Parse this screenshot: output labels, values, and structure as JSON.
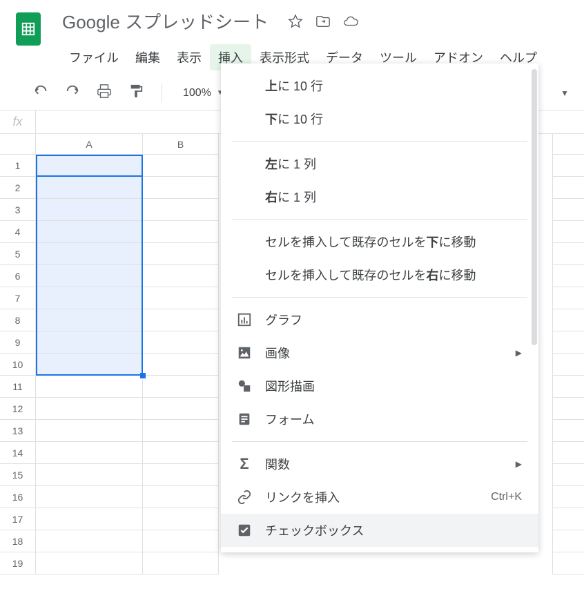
{
  "doc_title": "Google スプレッドシート",
  "menubar": {
    "file": "ファイル",
    "edit": "編集",
    "view": "表示",
    "insert": "挿入",
    "format": "表示形式",
    "data": "データ",
    "tools": "ツール",
    "addons": "アドオン",
    "help": "ヘルプ"
  },
  "toolbar": {
    "zoom": "100%"
  },
  "columns": [
    "A",
    "B"
  ],
  "rows": [
    "1",
    "2",
    "3",
    "4",
    "5",
    "6",
    "7",
    "8",
    "9",
    "10",
    "11",
    "12",
    "13",
    "14",
    "15",
    "16",
    "17",
    "18",
    "19"
  ],
  "dropdown": {
    "rows_above_pre": "上",
    "rows_above_post": "に 10 行",
    "rows_below_pre": "下",
    "rows_below_post": "に 10 行",
    "cols_left_pre": "左",
    "cols_left_post": "に 1 列",
    "cols_right_pre": "右",
    "cols_right_post": "に 1 列",
    "shift_down_pre": "セルを挿入して既存のセルを",
    "shift_down_bold": "下",
    "shift_down_post": "に移動",
    "shift_right_pre": "セルを挿入して既存のセルを",
    "shift_right_bold": "右",
    "shift_right_post": "に移動",
    "chart": "グラフ",
    "image": "画像",
    "drawing": "図形描画",
    "form": "フォーム",
    "function": "関数",
    "link": "リンクを挿入",
    "link_shortcut": "Ctrl+K",
    "checkbox": "チェックボックス"
  }
}
